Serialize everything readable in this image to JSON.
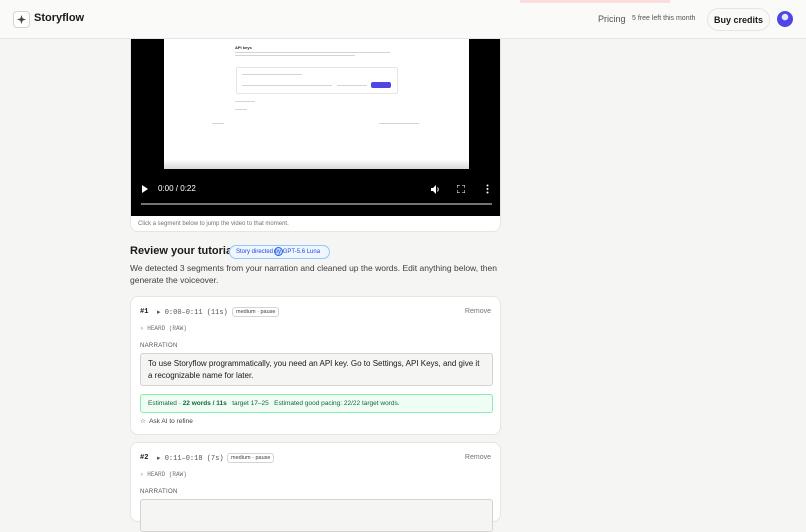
{
  "header": {
    "brand": "Storyflow",
    "pricing": "Pricing",
    "credits_left": "5 free left this month",
    "buy_credits": "Buy credits"
  },
  "video": {
    "frame_title": "API keys",
    "time": "0:00 / 0:22",
    "hint": "Click a segment below to jump the video to that moment."
  },
  "review": {
    "title": "Review your tutorial",
    "director_pill": "Story directed by GPT-5.6 Luna",
    "description": "We detected 3 segments from your narration and cleaned up the words. Edit anything below, then generate the voiceover."
  },
  "segments": [
    {
      "num": "#1",
      "time": "0:00–0:11 (11s)",
      "tag": "medium · pause",
      "remove": "Remove",
      "heard": "HEARD (RAW)",
      "narration_label": "NARRATION",
      "narration": "To use Storyflow programmatically, you need an API key. Go to Settings, API Keys, and give it a recognizable name for later.",
      "estimate_prefix": "Estimated · ",
      "estimate_words": "22 words / 11s",
      "estimate_target": "target 17–25",
      "estimate_note": "Estimated good pacing: 22/22 target words.",
      "ask_ai": "Ask AI to refine"
    },
    {
      "num": "#2",
      "time": "0:11–0:18 (7s)",
      "tag": "medium · pause",
      "remove": "Remove",
      "heard": "HEARD (RAW)",
      "narration_label": "NARRATION"
    }
  ]
}
